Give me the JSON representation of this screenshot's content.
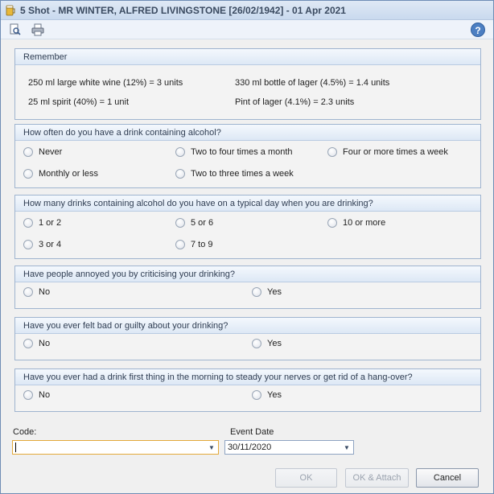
{
  "window": {
    "title": "5 Shot - MR WINTER, ALFRED LIVINGSTONE [26/02/1942] - 01 Apr 2021"
  },
  "toolbar": {
    "icons": [
      "preview-icon",
      "print-icon",
      "help-icon"
    ],
    "help_glyph": "?"
  },
  "remember": {
    "heading": "Remember",
    "items": [
      "250 ml large white wine (12%) = 3 units",
      "330 ml bottle of lager (4.5%) = 1.4 units",
      "25 ml spirit (40%) = 1 unit",
      "Pint of lager (4.1%) = 2.3 units"
    ]
  },
  "questions": [
    {
      "text": "How often do you have a drink containing alcohol?",
      "options": [
        "Never",
        "Two to four times a month",
        "Four or more times a week",
        "Monthly or less",
        "Two to three times a week"
      ]
    },
    {
      "text": "How many drinks containing alcohol do you have on a typical day when you are drinking?",
      "options": [
        "1 or 2",
        "5 or 6",
        "10 or more",
        "3 or 4",
        "7 to 9"
      ]
    },
    {
      "text": "Have people annoyed you by criticising your drinking?",
      "options": [
        "No",
        "Yes"
      ]
    },
    {
      "text": "Have you ever felt bad or guilty about your drinking?",
      "options": [
        "No",
        "Yes"
      ]
    },
    {
      "text": "Have you ever had a drink first thing in the morning to steady your nerves or get rid of a hang-over?",
      "options": [
        "No",
        "Yes"
      ]
    }
  ],
  "form": {
    "code_label": "Code:",
    "code_value": "",
    "event_date_label": "Event Date",
    "event_date_value": "30/11/2020"
  },
  "buttons": {
    "ok": "OK",
    "ok_attach": "OK & Attach",
    "cancel": "Cancel"
  },
  "colors": {
    "panel_border": "#9fb4cf",
    "focus_border": "#e3a93a",
    "accent": "#4c7fc2"
  }
}
